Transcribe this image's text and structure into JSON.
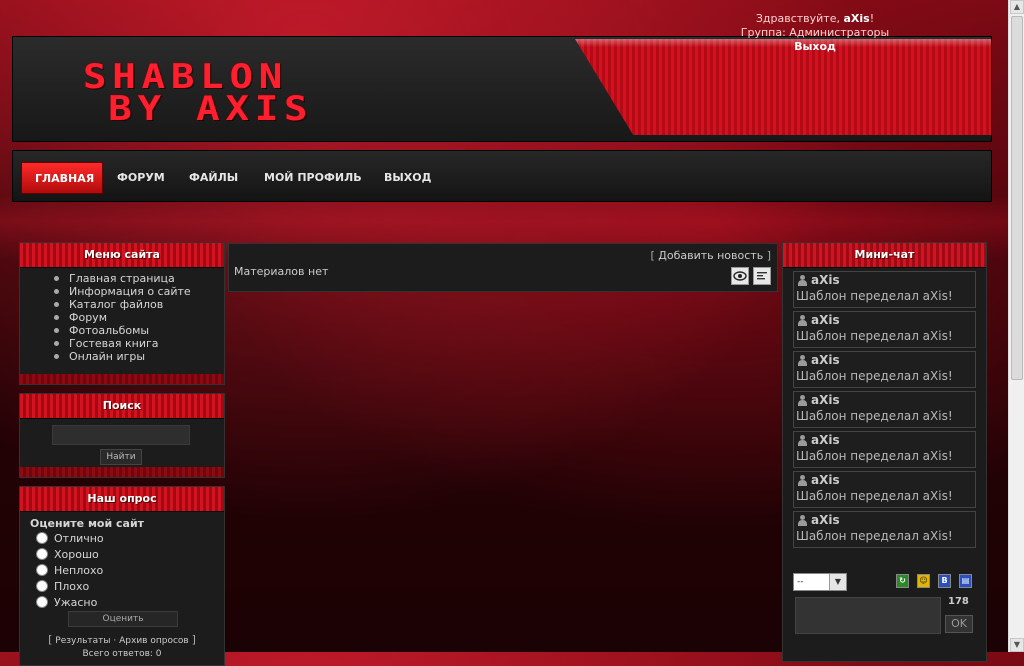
{
  "header": {
    "logo_line1": "SHABLON",
    "logo_line2": "BY AXIS",
    "greeting": "Здравствуйте,",
    "username": "aXis",
    "greeting_end": "!",
    "group_label": "Группа: Администраторы",
    "logout": "Выход"
  },
  "nav": {
    "items": [
      {
        "label": "ГЛАВНАЯ"
      },
      {
        "label": "ФОРУМ"
      },
      {
        "label": "ФАЙЛЫ"
      },
      {
        "label": "МОЙ ПРОФИЛЬ"
      },
      {
        "label": "ВЫХОД"
      }
    ]
  },
  "site_menu": {
    "title": "Меню сайта",
    "items": [
      "Главная страница",
      "Информация о сайте",
      "Каталог файлов",
      "Форум",
      "Фотоальбомы",
      "Гостевая книга",
      "Онлайн игры"
    ]
  },
  "search": {
    "title": "Поиск",
    "button": "Найти"
  },
  "poll": {
    "title": "Наш опрос",
    "question": "Оцените мой сайт",
    "options": [
      "Отлично",
      "Хорошо",
      "Неплохо",
      "Плохо",
      "Ужасно"
    ],
    "vote_button": "Оценить",
    "results_link": "Результаты",
    "separator": "·",
    "archive_link": "Архив опросов",
    "total_votes": "Всего ответов: 0"
  },
  "content": {
    "add_news": "Добавить новость",
    "no_materials": "Материалов нет",
    "view_icon": "eye-icon",
    "list_icon": "list-icon"
  },
  "chat": {
    "title": "Мини-чат",
    "messages": [
      {
        "nick": "aXis",
        "text": "Шаблон переделал aXis!"
      },
      {
        "nick": "aXis",
        "text": "Шаблон переделал aXis!"
      },
      {
        "nick": "aXis",
        "text": "Шаблон переделал aXis!"
      },
      {
        "nick": "aXis",
        "text": "Шаблон переделал aXis!"
      },
      {
        "nick": "aXis",
        "text": "Шаблон переделал aXis!"
      },
      {
        "nick": "aXis",
        "text": "Шаблон переделал aXis!"
      },
      {
        "nick": "aXis",
        "text": "Шаблон переделал aXis!"
      }
    ],
    "smile_select_value": "--",
    "char_count": "178",
    "ok_button": "OK"
  },
  "colors": {
    "accent": "#d11420",
    "background": "#1c1c1c"
  }
}
